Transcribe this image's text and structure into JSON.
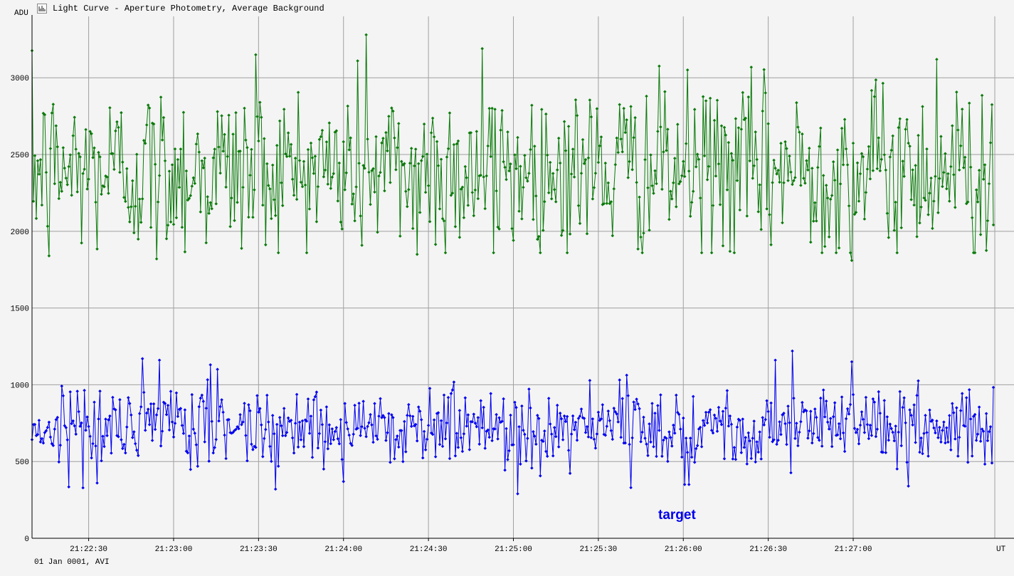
{
  "window": {
    "title": "Light Curve - Aperture Photometry, Average Background",
    "icon": "chart-icon"
  },
  "footer": {
    "date_text": "01 Jan 0001, AVI"
  },
  "colors": {
    "background": "#f4f4f4",
    "grid": "#a0a0a0",
    "comparison": "#0a7a0a",
    "target": "#0000ee"
  },
  "chart_data": {
    "type": "line",
    "title": "Light Curve - Aperture Photometry, Average Background",
    "ylabel": "ADU",
    "xlabel": "UT",
    "ylim": [
      0,
      3400
    ],
    "yticks": [
      0,
      500,
      1000,
      1500,
      2000,
      2500,
      3000
    ],
    "ytick_labels": [
      "0",
      "500",
      "1000",
      "1500",
      "2000",
      "2500",
      "3000"
    ],
    "xrange": [
      "21:22:10",
      "21:27:50"
    ],
    "xticks": [
      "21:22:30",
      "21:23:00",
      "21:23:30",
      "21:24:00",
      "21:24:30",
      "21:25:00",
      "21:25:30",
      "21:26:00",
      "21:26:30",
      "21:27:00"
    ],
    "grid": true,
    "series": [
      {
        "name": "",
        "color": "#0a7a0a",
        "mean": 2400,
        "std": 280,
        "min": 1820,
        "max": 3280,
        "peaks": [
          {
            "t": "21:23:29",
            "value": 3150
          },
          {
            "t": "21:24:05",
            "value": 3110
          },
          {
            "t": "21:24:08",
            "value": 3280
          },
          {
            "t": "21:24:49",
            "value": 3190
          },
          {
            "t": "21:27:00",
            "value": 3220
          },
          {
            "t": "21:27:30",
            "value": 3120
          }
        ],
        "troughs": [
          {
            "t": "21:22:16",
            "value": 1840
          },
          {
            "t": "21:22:54",
            "value": 1820
          },
          {
            "t": "21:24:26",
            "value": 1850
          },
          {
            "t": "21:24:53",
            "value": 1860
          },
          {
            "t": "21:27:00",
            "value": 1810
          }
        ]
      },
      {
        "name": "target",
        "color": "#0000ee",
        "mean": 730,
        "std": 130,
        "min": 280,
        "max": 1230,
        "peaks": [
          {
            "t": "21:22:55",
            "value": 1160
          },
          {
            "t": "21:23:13",
            "value": 1130
          },
          {
            "t": "21:26:01",
            "value": 1230
          },
          {
            "t": "21:26:33",
            "value": 1160
          },
          {
            "t": "21:26:39",
            "value": 1220
          },
          {
            "t": "21:27:00",
            "value": 1150
          }
        ],
        "troughs": [
          {
            "t": "21:22:33",
            "value": 360
          },
          {
            "t": "21:25:02",
            "value": 290
          },
          {
            "t": "21:25:42",
            "value": 330
          },
          {
            "t": "21:26:01",
            "value": 350
          },
          {
            "t": "21:27:20",
            "value": 340
          }
        ]
      }
    ],
    "annotations": [
      {
        "text": "target",
        "color": "#0000ee"
      }
    ],
    "sample_count": 680
  }
}
